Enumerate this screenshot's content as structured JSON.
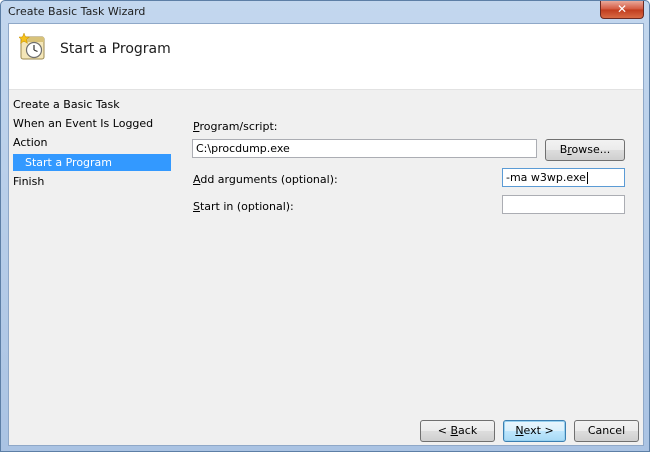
{
  "window": {
    "title": "Create Basic Task Wizard",
    "close_glyph": "✕"
  },
  "header": {
    "title": "Start a Program",
    "icon": "task-scheduler-icon"
  },
  "nav": {
    "items": [
      {
        "label": "Create a Basic Task"
      },
      {
        "label": "When an Event Is Logged"
      },
      {
        "label": "Action"
      },
      {
        "label": "Start a Program",
        "selected": true
      },
      {
        "label": "Finish"
      }
    ]
  },
  "form": {
    "program_label_pre": "",
    "program_label_u": "P",
    "program_label_post": "rogram/script:",
    "program_value": "C:\\procdump.exe",
    "browse_pre": "B",
    "browse_u": "r",
    "browse_post": "owse...",
    "args_label_pre": "",
    "args_label_u": "A",
    "args_label_post": "dd arguments (optional):",
    "args_value": "-ma w3wp.exe",
    "startin_label_pre": "",
    "startin_label_u": "S",
    "startin_label_post": "tart in (optional):",
    "startin_value": ""
  },
  "buttons": {
    "back_pre": "< ",
    "back_u": "B",
    "back_post": "ack",
    "next_pre": "",
    "next_u": "N",
    "next_post": "ext >",
    "cancel": "Cancel"
  },
  "colors": {
    "selection": "#3399ff",
    "panel": "#f0f0f0",
    "frame": "#aac3e3"
  }
}
